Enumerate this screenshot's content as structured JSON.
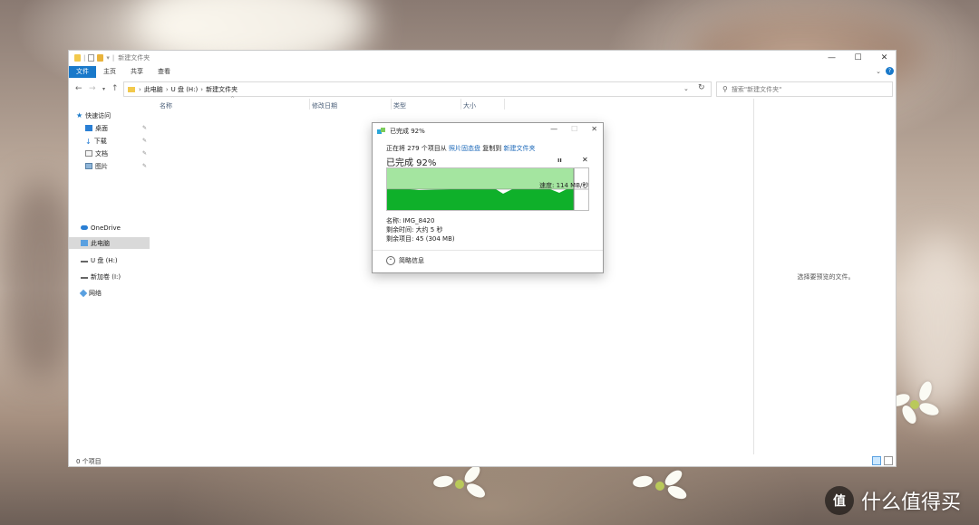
{
  "window": {
    "title": "新建文件夹",
    "minimize_glyph": "—",
    "maximize_glyph": "☐",
    "close_glyph": "✕"
  },
  "ribbon": {
    "tabs": [
      "文件",
      "主页",
      "共享",
      "查看"
    ],
    "active_tab": "文件",
    "accent_color": "#1979ca"
  },
  "address_bar": {
    "breadcrumbs": [
      "此电脑",
      "U 盘 (H:)",
      "新建文件夹"
    ],
    "search_placeholder": "搜索\"新建文件夹\""
  },
  "nav_pane": {
    "quick_access": "快速访问",
    "quick_items": [
      {
        "label": "桌面",
        "icon": "desktop-icon"
      },
      {
        "label": "下载",
        "icon": "download-icon"
      },
      {
        "label": "文档",
        "icon": "document-icon"
      },
      {
        "label": "图片",
        "icon": "pictures-icon"
      }
    ],
    "onedrive": "OneDrive",
    "this_pc": "此电脑",
    "usb": "U 盘 (H:)",
    "new_volume": "新加卷 (I:)",
    "network": "网络"
  },
  "columns": {
    "name": "名称",
    "modified": "修改日期",
    "type": "类型",
    "size": "大小"
  },
  "preview": {
    "empty_text": "选择要预览的文件。"
  },
  "status": {
    "item_count": "0 个项目"
  },
  "copy_dialog": {
    "title": "已完成 92%",
    "line_prefix": "正在将 279 个项目从",
    "source": "照片固态盘",
    "line_mid": "复制到",
    "destination": "新建文件夹",
    "percent_label": "已完成 92%",
    "progress": 0.92,
    "speed": "速度: 114 MB/秒",
    "name_line": "名称: IMG_8420",
    "time_line": "剩余时间: 大约 5 秒",
    "items_line": "剩余项目: 45 (304 MB)",
    "less_info": "简略信息",
    "graph_color_light": "#a4e5a0",
    "graph_color_dark": "#0fb02a"
  },
  "watermark": {
    "badge": "值",
    "text": "什么值得买"
  }
}
